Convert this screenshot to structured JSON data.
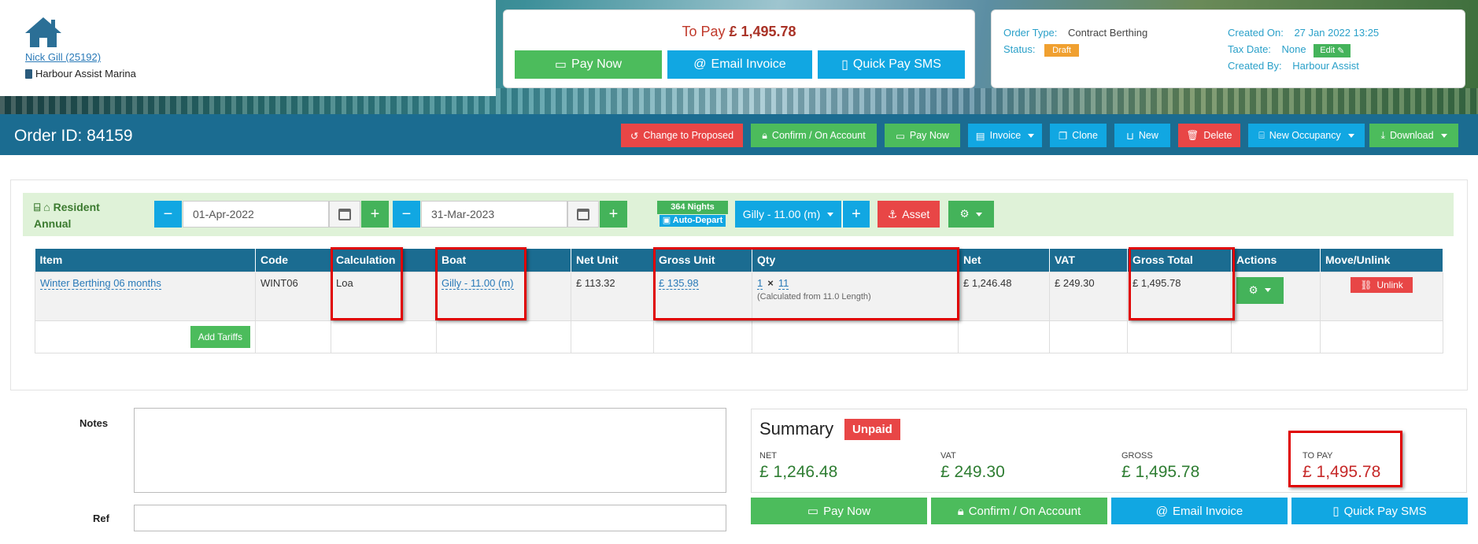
{
  "user": {
    "name": "Nick Gill (25192)",
    "marina": "Harbour Assist Marina"
  },
  "pay_card": {
    "to_pay_label": "To Pay",
    "to_pay_amount": "£ 1,495.78",
    "buttons": {
      "pay_now": "Pay Now",
      "email_invoice": "Email Invoice",
      "quick_pay_sms": "Quick Pay SMS"
    }
  },
  "order_info": {
    "order_type_label": "Order Type:",
    "order_type": "Contract Berthing",
    "status_label": "Status:",
    "status": "Draft",
    "created_on_label": "Created On:",
    "created_on": "27 Jan 2022 13:25",
    "tax_date_label": "Tax Date:",
    "tax_date": "None",
    "edit_label": "Edit",
    "created_by_label": "Created By:",
    "created_by": "Harbour Assist"
  },
  "order_bar": {
    "order_id": "Order ID: 84159",
    "buttons": {
      "change_to_proposed": "Change to Proposed",
      "confirm_on_account": "Confirm / On Account",
      "pay_now": "Pay Now",
      "invoice": "Invoice",
      "clone": "Clone",
      "new": "New",
      "delete": "Delete",
      "new_occupancy": "New Occupancy",
      "download": "Download"
    }
  },
  "occupancy": {
    "label_line1": "Resident",
    "label_line2": "Annual",
    "start_date": "01-Apr-2022",
    "end_date": "31-Mar-2023",
    "nights": "364 Nights",
    "auto_depart": "Auto-Depart",
    "boat": "Gilly - 11.00 (m)",
    "asset": "Asset"
  },
  "table": {
    "headers": [
      "Item",
      "Code",
      "Calculation",
      "Boat",
      "Net Unit",
      "Gross Unit",
      "Qty",
      "Net",
      "VAT",
      "Gross Total",
      "Actions",
      "Move/Unlink"
    ],
    "rows": [
      {
        "item": "Winter Berthing 06 months",
        "code": "WINT06",
        "calculation": "Loa",
        "boat": "Gilly - 11.00 (m)",
        "net_unit": "£ 113.32",
        "gross_unit": "£ 135.98",
        "qty_a": "1",
        "qty_b": "11",
        "qty_note": "(Calculated from 11.0 Length)",
        "net": "£ 1,246.48",
        "vat": "£ 249.30",
        "gross_total": "£ 1,495.78",
        "unlink": "Unlink"
      }
    ],
    "add_tariffs": "Add Tariffs"
  },
  "notes_label": "Notes",
  "ref_label": "Ref",
  "summary": {
    "title": "Summary",
    "badge": "Unpaid",
    "net_label": "NET",
    "net": "£ 1,246.48",
    "vat_label": "VAT",
    "vat": "£ 249.30",
    "gross_label": "GROSS",
    "gross": "£ 1,495.78",
    "to_pay_label": "TO PAY",
    "to_pay": "£ 1,495.78"
  },
  "bottom_buttons": {
    "pay_now": "Pay Now",
    "confirm_on_account": "Confirm / On Account",
    "email_invoice": "Email Invoice",
    "quick_pay_sms": "Quick Pay SMS"
  },
  "colors": {
    "header_blue": "#1b6c91",
    "green": "#4cbc5c",
    "cyan": "#11a7e2",
    "red": "#e84646",
    "highlight": "#e00000"
  }
}
